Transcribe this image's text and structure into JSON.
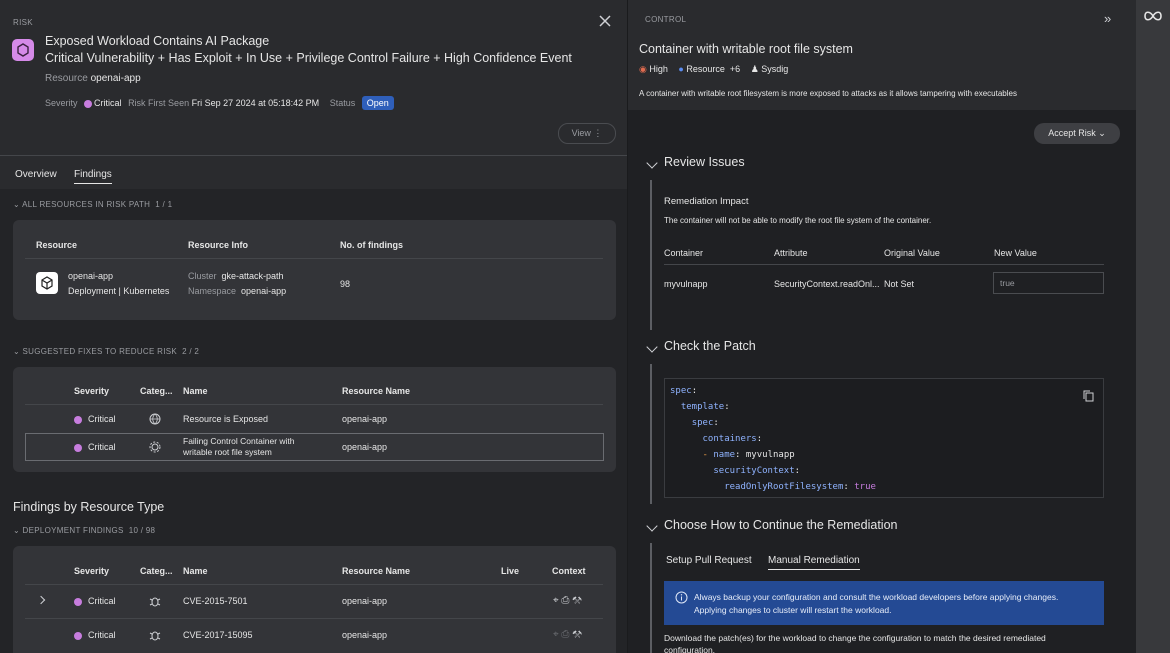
{
  "risk": {
    "section": "RISK",
    "title1": "Exposed Workload Contains AI Package",
    "title2": "Critical Vulnerability + Has Exploit + In Use + Privilege Control Failure + High Confidence Event",
    "resource_label": "Resource",
    "resource": "openai-app",
    "severity_label": "Severity",
    "severity": "Critical",
    "first_seen_label": "Risk First Seen",
    "first_seen": "Fri Sep 27 2024 at 05:18:42 PM",
    "status_label": "Status",
    "status": "Open",
    "view_label": "View"
  },
  "tabs": [
    {
      "label": "Overview"
    },
    {
      "label": "Findings"
    }
  ],
  "risk_path": {
    "header": "ALL RESOURCES IN RISK PATH",
    "count": "1 / 1",
    "cols": [
      "Resource",
      "Resource Info",
      "No. of findings"
    ],
    "row": {
      "name": "openai-app",
      "type": "Deployment | Kubernetes",
      "cluster_label": "Cluster",
      "cluster": "gke-attack-path",
      "ns_label": "Namespace",
      "ns": "openai-app",
      "findings": "98"
    }
  },
  "fixes": {
    "header": "SUGGESTED FIXES TO REDUCE RISK",
    "count": "2 / 2",
    "cols": [
      "Severity",
      "Categ...",
      "Name",
      "Resource Name"
    ],
    "rows": [
      {
        "severity": "Critical",
        "name": "Resource is Exposed",
        "resource": "openai-app"
      },
      {
        "severity": "Critical",
        "name": "Failing Control Container with writable root file system",
        "resource": "openai-app"
      }
    ]
  },
  "findings": {
    "title": "Findings by Resource Type",
    "header": "DEPLOYMENT FINDINGS",
    "count": "10 / 98",
    "cols": [
      "Severity",
      "Categ...",
      "Name",
      "Resource Name",
      "Live",
      "Context"
    ],
    "rows": [
      {
        "severity": "Critical",
        "name": "CVE-2015-7501",
        "resource": "openai-app"
      },
      {
        "severity": "Critical",
        "name": "CVE-2017-15095",
        "resource": "openai-app"
      }
    ]
  },
  "control": {
    "section": "CONTROL",
    "title": "Container with writable root file system",
    "severity": "High",
    "resource_label": "Resource",
    "resource_extra": "+6",
    "owner": "Sysdig",
    "description": "A container with writable root filesystem is more exposed to attacks as it allows tampering with executables",
    "accept_label": "Accept Risk"
  },
  "review": {
    "title": "Review Issues",
    "impact_title": "Remediation Impact",
    "impact_text": "The container will not be able to modify the root file system of the container.",
    "cols": [
      "Container",
      "Attribute",
      "Original Value",
      "New Value"
    ],
    "row": {
      "container": "myvulnapp",
      "attribute": "SecurityContext.readOnl...",
      "original": "Not Set",
      "new": "true"
    }
  },
  "patch": {
    "title": "Check the Patch",
    "lines": {
      "l1k": "spec",
      "l2k": "template",
      "l3k": "spec",
      "l4k": "containers",
      "l5k": "name",
      "l5v": "myvulnapp",
      "l6k": "securityContext",
      "l7k": "readOnlyRootFilesystem",
      "l7v": "true"
    }
  },
  "choose": {
    "title": "Choose How to Continue the Remediation",
    "tab1": "Setup Pull Request",
    "tab2": "Manual Remediation",
    "info": "Always backup your configuration and consult the workload developers before applying changes.",
    "info2": "Applying changes to cluster will restart the workload.",
    "download": "Download the patch(es) for the workload to change the configuration to match the desired remediated",
    "download2": "configuration."
  },
  "colors": {
    "critical": "#c77dde",
    "accent": "#2f5fba"
  }
}
